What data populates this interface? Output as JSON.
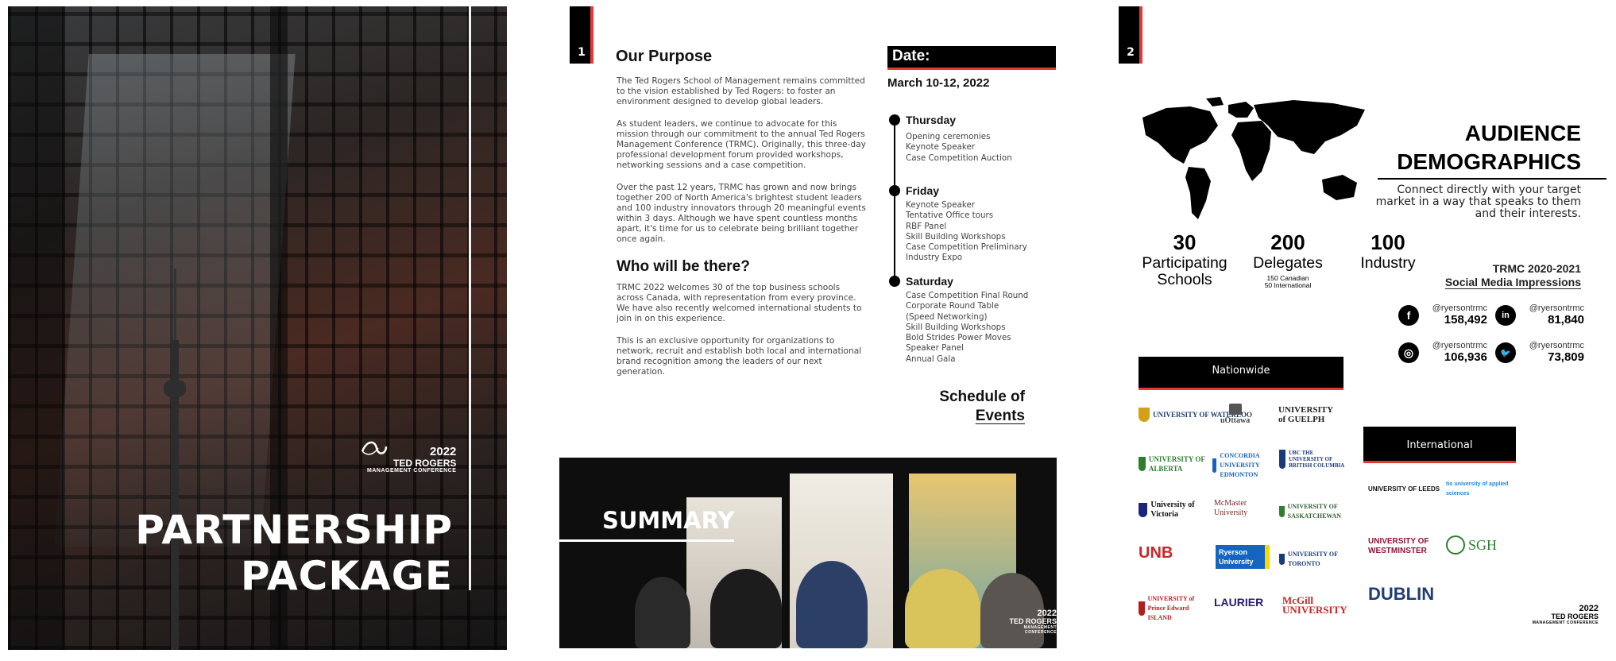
{
  "cover": {
    "logo_year": "2022",
    "logo_name": "TED ROGERS",
    "logo_sub": "MANAGEMENT CONFERENCE",
    "title_line1": "PARTNERSHIP",
    "title_line2": "PACKAGE"
  },
  "page1": {
    "page_number": "1",
    "purpose_heading": "Our Purpose",
    "purpose_p1": "The Ted Rogers School of Management remains committed to the vision established by Ted Rogers: to foster an environment designed to develop global leaders.",
    "purpose_p2": "As student leaders, we continue to advocate for this mission through our commitment to the annual Ted Rogers Management Conference (TRMC). Originally, this three-day professional development forum provided workshops, networking sessions and a case competition.",
    "purpose_p3": "Over the past 12 years, TRMC has grown and now brings together 200 of North America's brightest student leaders and 100 industry innovators through 20 meaningful events within 3 days. Although we have spent countless months apart, it's time for us to celebrate being brilliant together once again.",
    "who_heading": "Who will be there?",
    "who_p1": "TRMC 2022 welcomes 30 of the top business schools across Canada, with representation from every province. We have also recently welcomed international students to join in on this experience.",
    "who_p2": "This is an exclusive opportunity for organizations to network, recruit and establish both local and international brand recognition among the leaders of our next generation.",
    "date_label": "Date:",
    "date_value": "March 10-12, 2022",
    "schedule": [
      {
        "day": "Thursday",
        "items": [
          "Opening ceremonies",
          "Keynote Speaker",
          "Case Competition Auction"
        ]
      },
      {
        "day": "Friday",
        "items": [
          "Keynote Speaker",
          "Tentative Office tours",
          "RBF Panel",
          "Skill Building Workshops",
          "Case Competition Preliminary",
          "Industry Expo"
        ]
      },
      {
        "day": "Saturday",
        "items": [
          "Case Competition Final Round",
          "Corporate Round Table",
          "(Speed Networking)",
          "Skill Building Workshops",
          "Bold Strides Power Moves",
          "Speaker Panel",
          "Annual Gala"
        ]
      }
    ],
    "schedule_title_line1": "Schedule of",
    "schedule_title_line2": "Events",
    "summary_title": "SUMMARY"
  },
  "page2": {
    "page_number": "2",
    "audience_line1": "AUDIENCE",
    "audience_line2": "DEMOGRAPHICS",
    "audience_sub": "Connect directly with your target market in a way that speaks to them and their interests.",
    "stats": [
      {
        "number": "30",
        "label1": "Participating",
        "label2": "Schools",
        "sub1": "",
        "sub2": ""
      },
      {
        "number": "200",
        "label1": "Delegates",
        "label2": "",
        "sub1": "150 Canadian",
        "sub2": "50 International"
      },
      {
        "number": "100",
        "label1": "Industry",
        "label2": "",
        "sub1": "",
        "sub2": ""
      }
    ],
    "social_title_line1": "TRMC 2020-2021",
    "social_title_line2": "Social Media Impressions",
    "social": [
      {
        "icon": "facebook-icon",
        "glyph": "f",
        "handle": "@ryersontrmc",
        "value": "158,492"
      },
      {
        "icon": "linkedin-icon",
        "glyph": "in",
        "handle": "@ryersontrmc",
        "value": "81,840"
      },
      {
        "icon": "instagram-icon",
        "glyph": "◎",
        "handle": "@ryersontrmc",
        "value": "106,936"
      },
      {
        "icon": "twitter-icon",
        "glyph": "🐦",
        "handle": "@ryersontrmc",
        "value": "73,809"
      }
    ],
    "nationwide_label": "Nationwide",
    "international_label": "International",
    "nationwide_schools": [
      "UNIVERSITY OF WATERLOO",
      "uOttawa",
      "UNIVERSITY of GUELPH",
      "UNIVERSITY OF ALBERTA",
      "CONCORDIA UNIVERSITY EDMONTON",
      "UBC THE UNIVERSITY OF BRITISH COLUMBIA",
      "University of Victoria",
      "McMaster University",
      "UNIVERSITY OF SASKATCHEWAN",
      "UNB",
      "Ryerson University",
      "UNIVERSITY OF TORONTO",
      "UNIVERSITY of Prince Edward ISLAND",
      "LAURIER",
      "McGill UNIVERSITY"
    ],
    "international_schools": [
      "UNIVERSITY OF LEEDS",
      "tio university of applied sciences",
      "UNIVERSITY OF WESTMINSTER",
      "SGH",
      "DUBLIN"
    ],
    "colors": {
      "accent": "#e53935",
      "dark": "#000000"
    }
  }
}
